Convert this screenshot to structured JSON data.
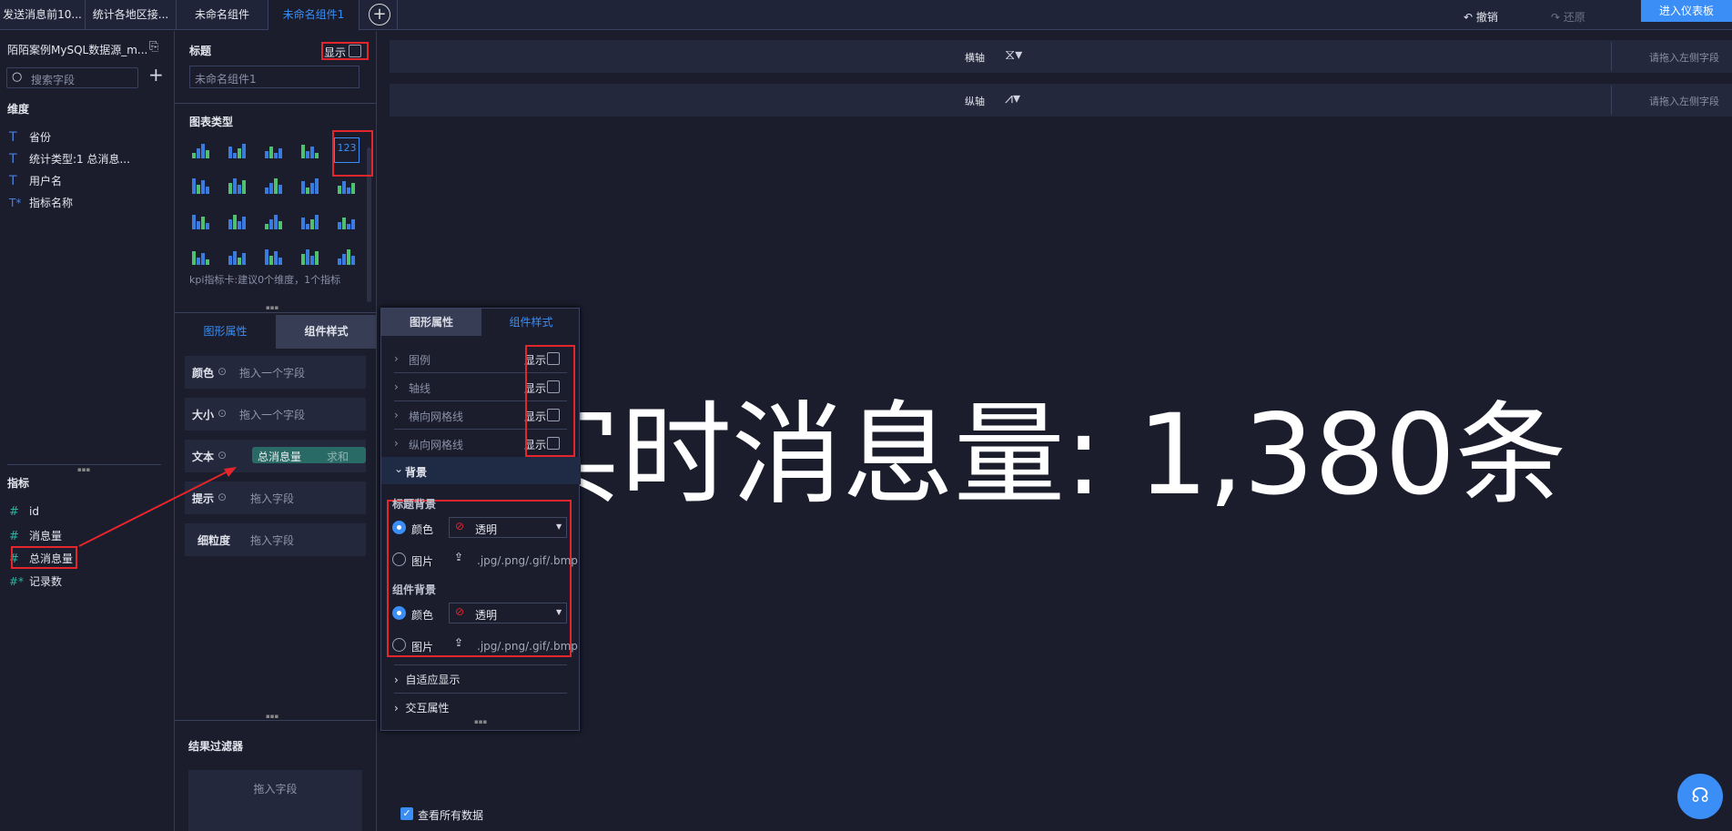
{
  "tabs": [
    {
      "label": "发送消息前10..."
    },
    {
      "label": "统计各地区接..."
    },
    {
      "label": "未命名组件"
    },
    {
      "label": "未命名组件1",
      "active": true
    }
  ],
  "toolbar": {
    "add_tab": "+",
    "undo": "撤销",
    "redo": "还原",
    "enter_dashboard": "进入仪表板",
    "accent": "#3a8ef6"
  },
  "left": {
    "datasource": "陌陌案例MySQL数据源_m...",
    "search_placeholder": "搜索字段",
    "add": "+",
    "dimensions_title": "维度",
    "dimensions": [
      {
        "icon": "T",
        "label": "省份"
      },
      {
        "icon": "T",
        "label": "统计类型:1 总消息..."
      },
      {
        "icon": "T",
        "label": "用户名"
      },
      {
        "icon": "T*",
        "label": "指标名称"
      }
    ],
    "measures_title": "指标",
    "measures": [
      {
        "icon": "#",
        "label": "id"
      },
      {
        "icon": "#",
        "label": "消息量"
      },
      {
        "icon": "#",
        "label": "总消息量",
        "highlighted": true
      },
      {
        "icon": "#*",
        "label": "记录数"
      }
    ]
  },
  "mid": {
    "title_label": "标题",
    "show_label": "显示",
    "show_checked": false,
    "title_placeholder": "未命名组件1",
    "chart_type_label": "图表类型",
    "chart_icons": [
      "table",
      "cross-table",
      "grid-table",
      "heat-table",
      "kpi-card",
      "progress-table",
      "indicator-table",
      "heatmap",
      "stacked-bar",
      "bar",
      "column",
      "horizontal-bar",
      "waterfall",
      "multi-line",
      "line-combo",
      "radar",
      "area",
      "scatter",
      "bubble",
      "pie"
    ],
    "selected_chart": "kpi-card",
    "selected_chart_text": "123",
    "chart_hint": "kpi指标卡:建议0个维度，1个指标",
    "tab_graph": "图形属性",
    "tab_style": "组件样式",
    "fields": [
      {
        "key": "颜色",
        "value": "拖入一个字段"
      },
      {
        "key": "大小",
        "value": "拖入一个字段"
      },
      {
        "key": "文本",
        "value": "总消息量",
        "agg": "求和"
      },
      {
        "key": "提示",
        "value": "拖入字段"
      },
      {
        "key": "细粒度",
        "value": "拖入字段"
      }
    ],
    "filter_title": "结果过滤器",
    "filter_drop": "拖入字段"
  },
  "axes": {
    "x_label": "横轴",
    "y_label": "纵轴",
    "drop_hint": "请拖入左侧字段"
  },
  "kpi_text": "实时消息量: 1,380条",
  "popup": {
    "tab_graph": "图形属性",
    "tab_style": "组件样式",
    "toggles": [
      {
        "label": "图例",
        "show": "显示"
      },
      {
        "label": "轴线",
        "show": "显示"
      },
      {
        "label": "横向网格线",
        "show": "显示"
      },
      {
        "label": "纵向网格线",
        "show": "显示"
      }
    ],
    "background": "背景",
    "title_bg": "标题背景",
    "comp_bg": "组件背景",
    "color": "颜色",
    "image": "图片",
    "transparent": "透明",
    "formats": ".jpg/.png/.gif/.bmp",
    "adaptive": "自适应显示",
    "interaction": "交互属性"
  },
  "bottom": {
    "view_all": "查看所有数据",
    "view_all_checked": true
  }
}
